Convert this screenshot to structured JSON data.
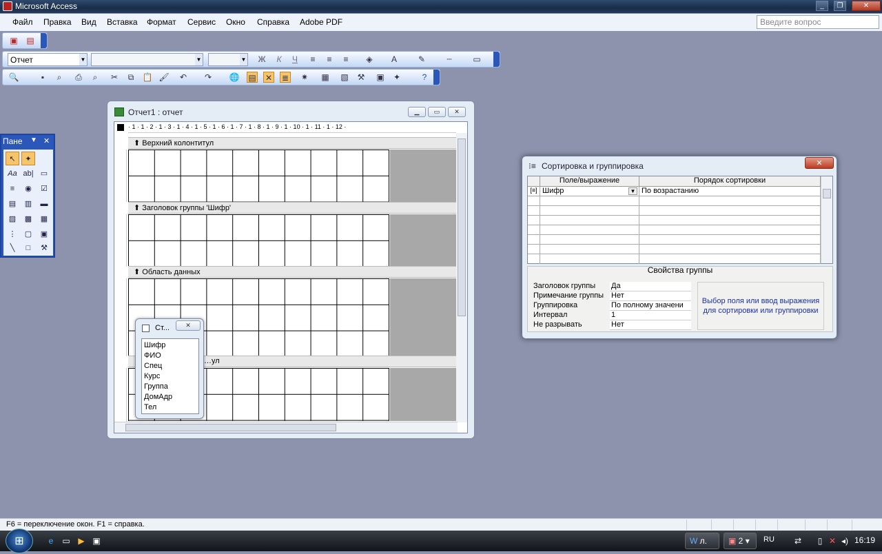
{
  "app": {
    "title": "Microsoft Access",
    "min": "_",
    "max": "❐",
    "close": "✕"
  },
  "menu": [
    "Файл",
    "Правка",
    "Вид",
    "Вставка",
    "Формат",
    "Сервис",
    "Окно",
    "Справка",
    "Adobe PDF"
  ],
  "help_placeholder": "Введите вопрос",
  "format_toolbar": {
    "object": "Отчет",
    "font": "",
    "size": "",
    "bold": "Ж",
    "italic": "К",
    "underline": "Ч"
  },
  "report_window": {
    "title": "Отчет1 : отчет",
    "ruler": "· 1 · 1 · 2 · 1 · 3 · 1 · 4 · 1 · 5 · 1 · 6 · 1 · 7 · 1 · 8 · 1 · 9 · 1 · 10 · 1 · 11 · 1 · 12 ·",
    "sections": [
      "Верхний колонтитул",
      "Заголовок группы 'Шифр'",
      "Область данных",
      "…ул"
    ]
  },
  "field_list": {
    "title": "Ст...",
    "fields": [
      "Шифр",
      "ФИО",
      "Спец",
      "Курс",
      "Группа",
      "ДомАдр",
      "Тел"
    ]
  },
  "toolbox": {
    "title": "Пане"
  },
  "sort_dialog": {
    "title": "Сортировка и группировка",
    "col_field": "Поле/выражение",
    "col_order": "Порядок сортировки",
    "row_field": "Шифр",
    "row_order": "По возрастанию",
    "props_title": "Свойства группы",
    "props": [
      {
        "label": "Заголовок группы",
        "value": "Да"
      },
      {
        "label": "Примечание группы",
        "value": "Нет"
      },
      {
        "label": "Группировка",
        "value": "По полному значени"
      },
      {
        "label": "Интервал",
        "value": "1"
      },
      {
        "label": "Не разрывать",
        "value": "Нет"
      }
    ],
    "hint": "Выбор поля или ввод выражения для сортировки или группировки"
  },
  "status": "F6 = переключение окон.  F1 = справка.",
  "taskbar": {
    "btn1": "л.",
    "btn2": "2",
    "lang": "RU",
    "time": "16:19"
  }
}
